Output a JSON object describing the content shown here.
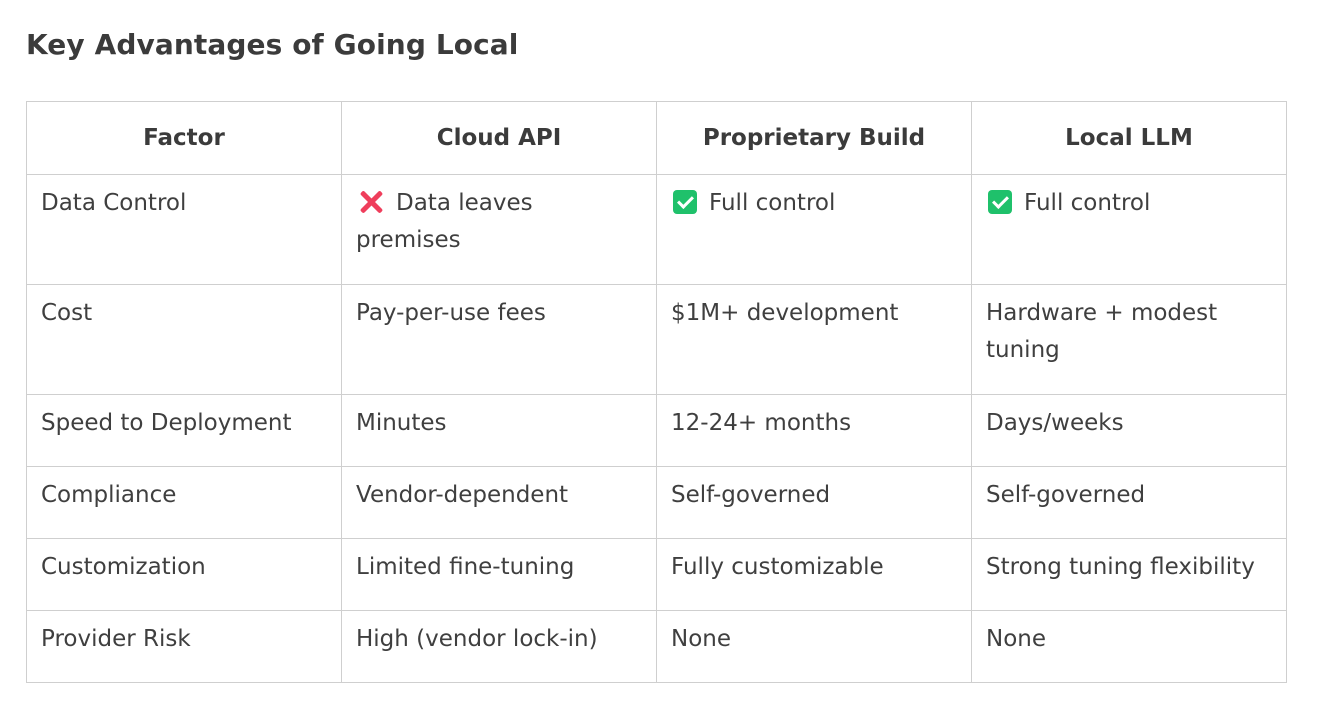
{
  "heading": "Key Advantages of Going Local",
  "table": {
    "headers": [
      "Factor",
      "Cloud API",
      "Proprietary Build",
      "Local LLM"
    ],
    "rows": [
      {
        "factor": "Data Control",
        "cloud_api": {
          "icon": "cross-mark-icon",
          "text": "Data leaves premises"
        },
        "proprietary_build": {
          "icon": "check-mark-icon",
          "text": "Full control"
        },
        "local_llm": {
          "icon": "check-mark-icon",
          "text": "Full control"
        }
      },
      {
        "factor": "Cost",
        "cloud_api": {
          "text": "Pay-per-use fees"
        },
        "proprietary_build": {
          "text": "$1M+ development"
        },
        "local_llm": {
          "text": "Hardware + modest tuning"
        }
      },
      {
        "factor": "Speed to Deployment",
        "cloud_api": {
          "text": "Minutes"
        },
        "proprietary_build": {
          "text": "12-24+ months"
        },
        "local_llm": {
          "text": "Days/weeks"
        }
      },
      {
        "factor": "Compliance",
        "cloud_api": {
          "text": "Vendor-dependent"
        },
        "proprietary_build": {
          "text": "Self-governed"
        },
        "local_llm": {
          "text": "Self-governed"
        }
      },
      {
        "factor": "Customization",
        "cloud_api": {
          "text": "Limited fine-tuning"
        },
        "proprietary_build": {
          "text": "Fully customizable"
        },
        "local_llm": {
          "text": "Strong tuning flexibility"
        }
      },
      {
        "factor": "Provider Risk",
        "cloud_api": {
          "text": "High (vendor lock-in)"
        },
        "proprietary_build": {
          "text": "None"
        },
        "local_llm": {
          "text": "None"
        }
      }
    ]
  },
  "colors": {
    "check": "#1fc16b",
    "cross": "#ef3e5c",
    "border": "#cfcfcf",
    "text": "#3a3a3a"
  }
}
